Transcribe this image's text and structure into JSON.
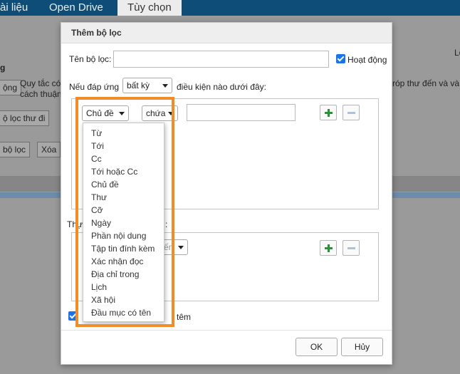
{
  "topbar": {
    "tabs": [
      "ài liệu",
      "Open Drive",
      "Tùy chọn"
    ]
  },
  "background": {
    "right_label": "Lọ",
    "rule_text_1": "Quy tắc có",
    "rule_text_2": "cách thuận",
    "rule_text_right": "róp thư đến và và",
    "left_g": "g",
    "btn_ong": "ộng",
    "btn_filter_out": "ộ lọc thư đi",
    "btn_filter": "bộ lọc",
    "btn_delete": "Xóa",
    "thr_fragment": "Thự",
    "thr_fragment_2": ":",
    "bottom_fragment": "têm"
  },
  "dialog": {
    "title": "Thêm bộ lọc",
    "filter_name_label": "Tên bộ lọc:",
    "filter_name_value": "",
    "active_label": "Hoạt động",
    "active_checked": true,
    "match_prefix": "Nếu đáp ứng",
    "match_select": "bất kỳ",
    "match_suffix": "điều kiện nào dưới đây:",
    "condition_field_select": "Chủ đề",
    "condition_op_select": "chứa",
    "condition_value": "",
    "action_select_fragment": "ến",
    "ok_label": "OK",
    "cancel_label": "Hủy"
  },
  "dropdown": {
    "items": [
      "Từ",
      "Tới",
      "Cc",
      "Tới hoặc Cc",
      "Chủ đề",
      "Thư",
      "Cỡ",
      "Ngày",
      "Phần nội dung",
      "Tập tin đính kèm",
      "Xác nhận đọc",
      "Địa chỉ trong",
      "Lịch",
      "Xã hội",
      "Đầu mục có tên"
    ]
  },
  "colors": {
    "topbar": "#0e4d78",
    "highlight": "#f28c28",
    "checkbox": "#1a73e8",
    "plus": "#1e9a2e"
  }
}
